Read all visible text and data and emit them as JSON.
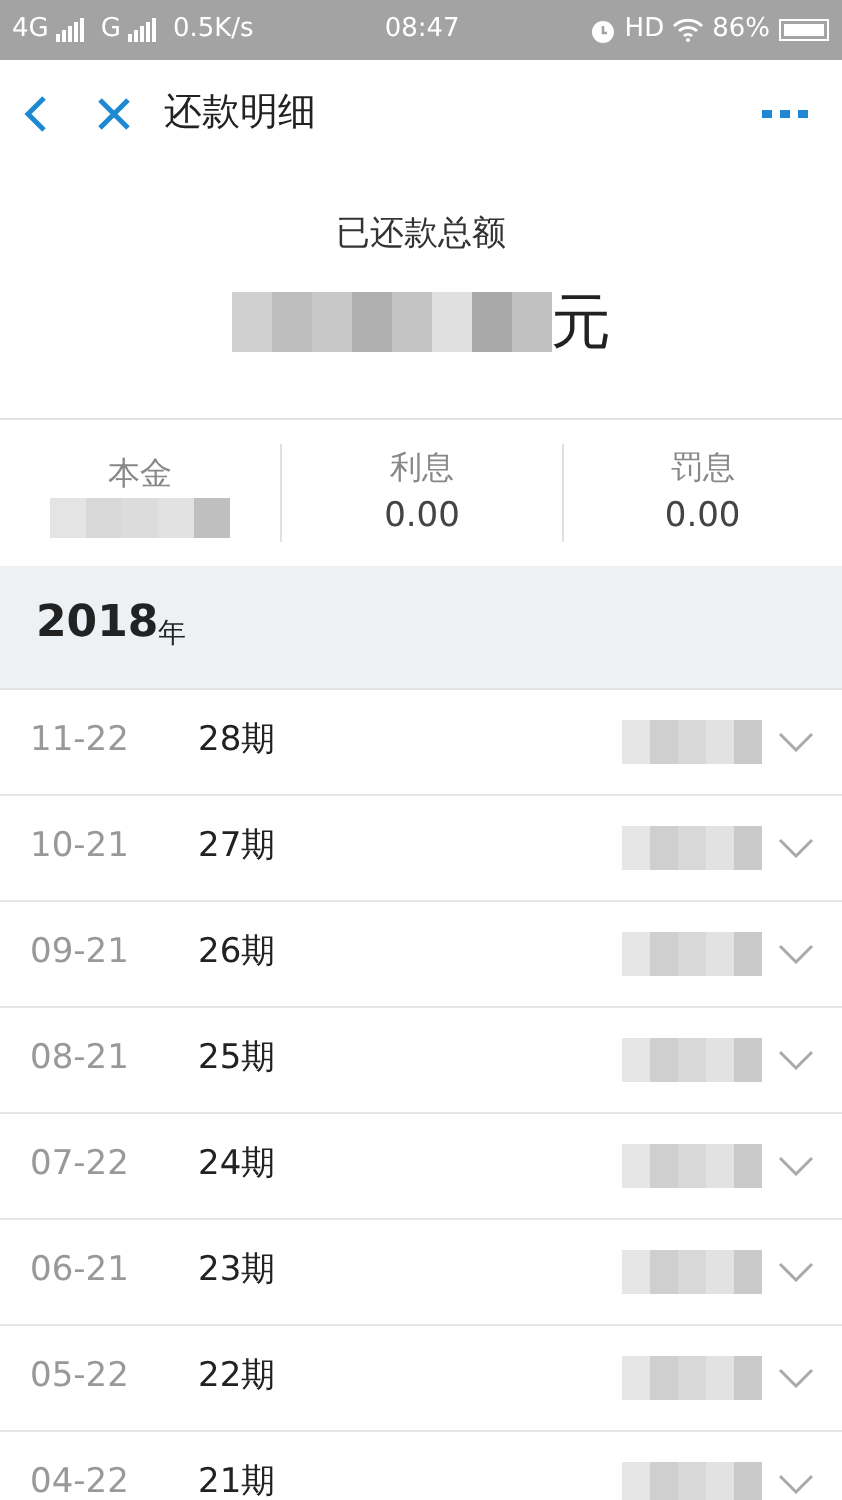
{
  "status_bar": {
    "network_1": "4G",
    "network_2": "G",
    "speed": "0.5K/s",
    "time": "08:47",
    "hd": "HD",
    "battery": "86%"
  },
  "header": {
    "title": "还款明细"
  },
  "summary": {
    "title": "已还款总额",
    "currency": "元"
  },
  "stats": [
    {
      "label": "本金",
      "value_redacted": true
    },
    {
      "label": "利息",
      "value": "0.00"
    },
    {
      "label": "罚息",
      "value": "0.00"
    }
  ],
  "year": {
    "number": "2018",
    "unit": "年"
  },
  "rows": [
    {
      "date": "11-22",
      "period": "28期"
    },
    {
      "date": "10-21",
      "period": "27期"
    },
    {
      "date": "09-21",
      "period": "26期"
    },
    {
      "date": "08-21",
      "period": "25期"
    },
    {
      "date": "07-22",
      "period": "24期"
    },
    {
      "date": "06-21",
      "period": "23期"
    },
    {
      "date": "05-22",
      "period": "22期"
    },
    {
      "date": "04-22",
      "period": "21期"
    }
  ]
}
